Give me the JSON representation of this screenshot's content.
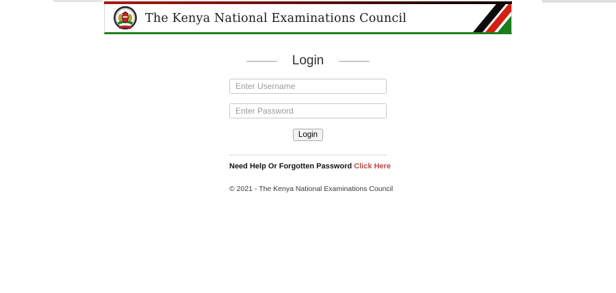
{
  "header": {
    "title": "The Kenya National Examinations Council",
    "logo_icon": "kenya-coat-of-arms",
    "colors": {
      "top_bar_red": "#a61b12",
      "top_bar_black": "#0d0101",
      "bottom_border_green": "#1e7e1e",
      "stripe_black": "#0c0c0c",
      "stripe_red": "#d32011",
      "stripe_green": "#1a7e1a"
    }
  },
  "login": {
    "heading": "Login",
    "username_placeholder": "Enter Username",
    "password_placeholder": "Enter Password",
    "button_label": "Login"
  },
  "help": {
    "text": "Need Help Or Forgotten Password ",
    "link_label": "Click Here",
    "link_color": "#b94a48"
  },
  "footer": {
    "copyright": "© 2021 - The Kenya National Examinations Council"
  }
}
